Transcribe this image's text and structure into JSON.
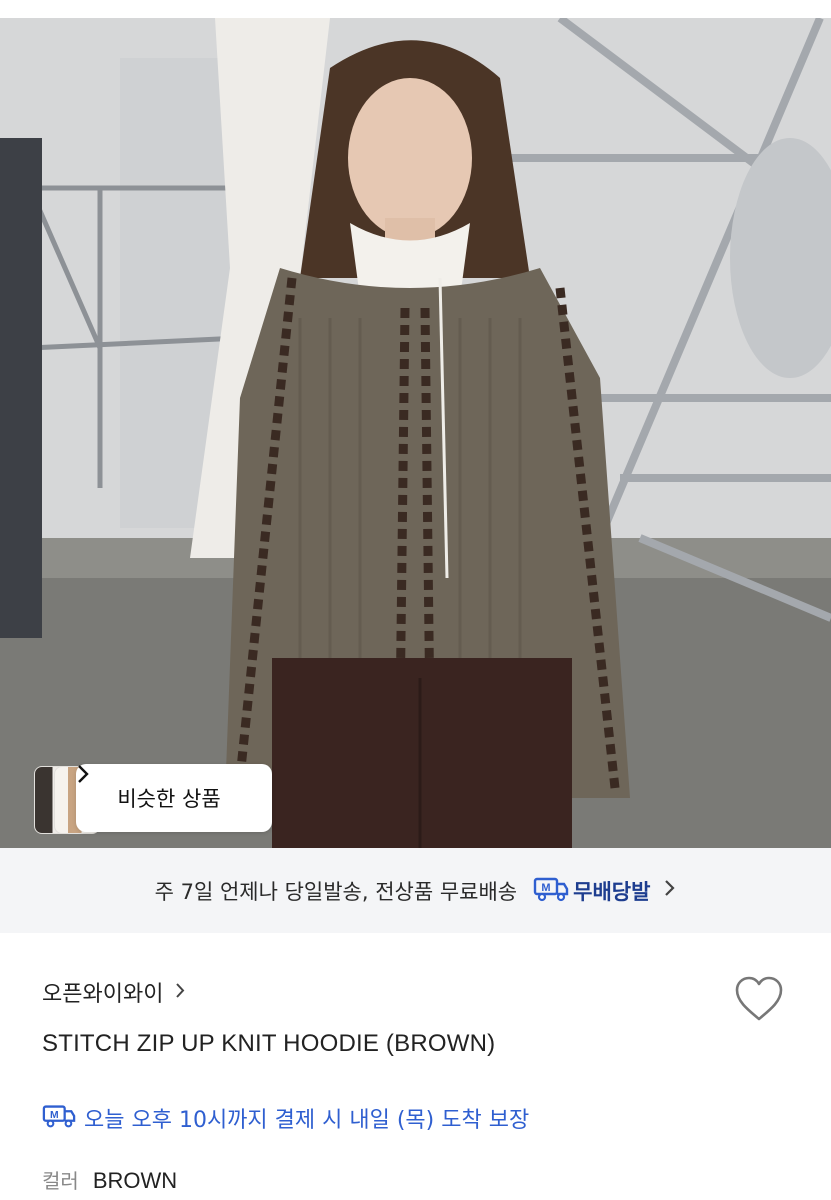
{
  "photo": {
    "similar_button_label": "비슷한 상품"
  },
  "shipping_banner": {
    "text": "주 7일 언제나 당일발송, 전상품 무료배송",
    "badge_label": "무배당발",
    "badge_icon": "truck-m-icon"
  },
  "product": {
    "brand": "오픈와이와이",
    "name": "STITCH ZIP UP KNIT HOODIE (BROWN)",
    "delivery_guarantee": "오늘 오후 10시까지 결제 시 내일 (목) 도착 보장",
    "option_label": "컬러",
    "option_value": "BROWN"
  },
  "icons": {
    "wishlist": "heart-outline-icon",
    "chevron": "chevron-right-icon"
  },
  "colors": {
    "accent_blue": "#2f5fd0",
    "badge_navy": "#1d3d8f",
    "banner_bg": "#f4f5f7"
  }
}
